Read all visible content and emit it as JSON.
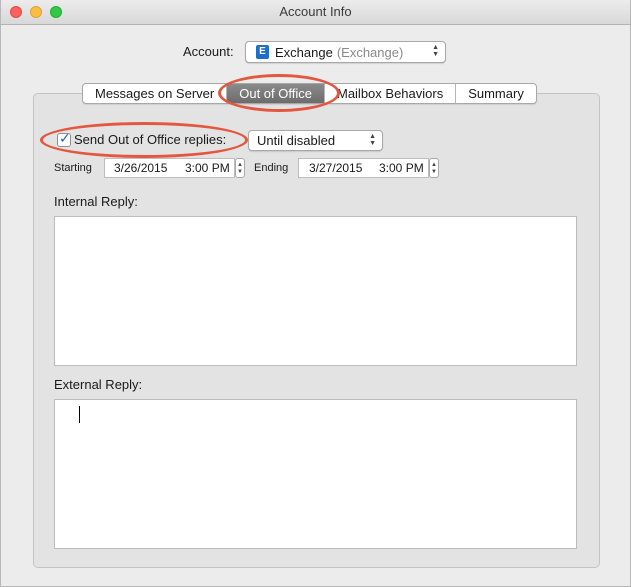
{
  "window": {
    "title": "Account Info"
  },
  "account": {
    "label": "Account:",
    "name": "Exchange",
    "type": "(Exchange)",
    "icon": "exchange-icon",
    "icon_glyph": "E"
  },
  "tabs": [
    {
      "label": "Messages on Server",
      "selected": false
    },
    {
      "label": "Out of Office",
      "selected": true
    },
    {
      "label": "Mailbox Behaviors",
      "selected": false
    },
    {
      "label": "Summary",
      "selected": false
    }
  ],
  "out_of_office": {
    "send_replies_label": "Send Out of Office replies:",
    "send_replies_checked": true,
    "duration_selected": "Until disabled",
    "starting_label": "Starting",
    "starting_date": "3/26/2015",
    "starting_time": "3:00 PM",
    "ending_label": "Ending",
    "ending_date": "3/27/2015",
    "ending_time": "3:00 PM",
    "internal_reply_label": "Internal Reply:",
    "internal_reply_value": "",
    "external_reply_label": "External Reply:",
    "external_reply_value": ""
  },
  "colors": {
    "annotation_oval": "#e4573f",
    "selected_tab": "#757575",
    "checkbox_check": "#1f5fbf"
  },
  "glyphs": {
    "checkmark": "✓",
    "popup_up": "▲",
    "popup_down": "▼"
  }
}
